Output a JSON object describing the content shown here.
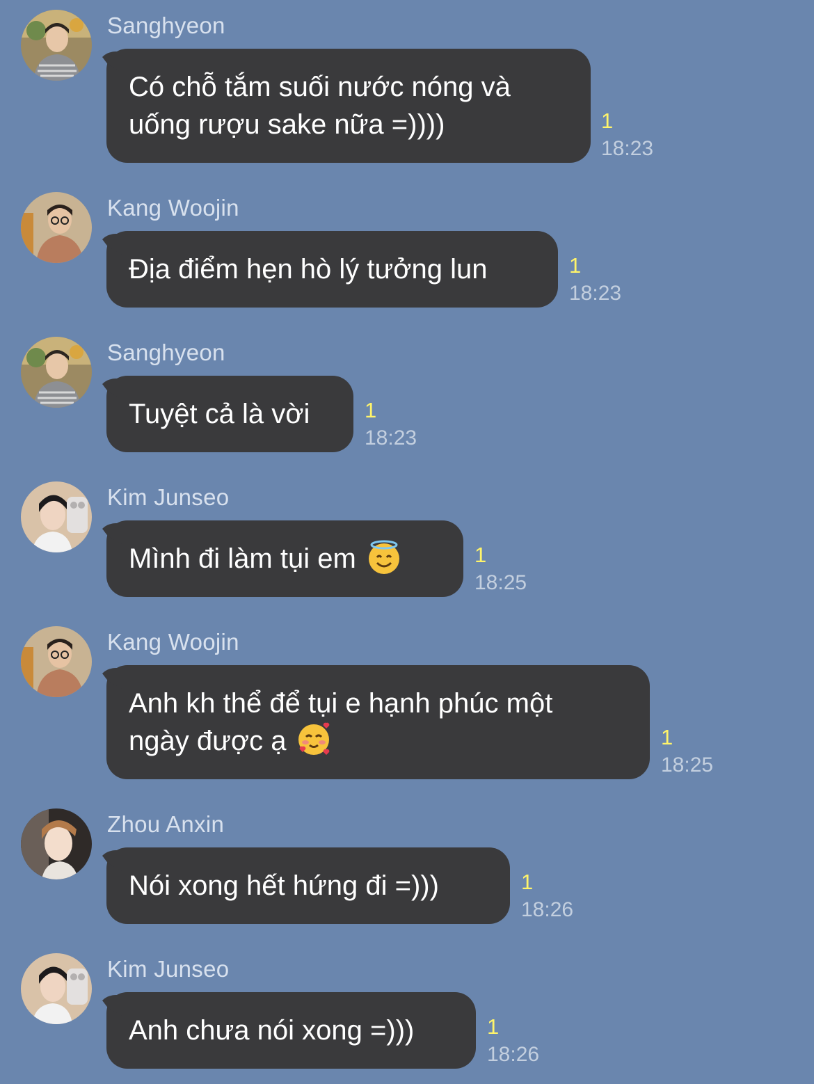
{
  "colors": {
    "background": "#6a86ae",
    "bubble": "#3a3a3c",
    "unread": "#fff46a",
    "time": "#c3cfdf"
  },
  "messages": [
    {
      "sender": "Sanghyeon",
      "avatar": "avatar-sanghyeon",
      "text": "Có chỗ tắm suối nước nóng và\nuống rượu sake nữa =))))",
      "unread": "1",
      "time": "18:23"
    },
    {
      "sender": "Kang Woojin",
      "avatar": "avatar-kang-woojin",
      "text": "Địa điểm hẹn hò lý tưởng lun",
      "unread": "1",
      "time": "18:23"
    },
    {
      "sender": "Sanghyeon",
      "avatar": "avatar-sanghyeon",
      "text": "Tuyệt cả là vời",
      "unread": "1",
      "time": "18:23"
    },
    {
      "sender": "Kim Junseo",
      "avatar": "avatar-kim-junseo",
      "text": "Mình đi làm tụi em",
      "emoji": "smiling-face-with-halo-emoji",
      "unread": "1",
      "time": "18:25"
    },
    {
      "sender": "Kang Woojin",
      "avatar": "avatar-kang-woojin",
      "text": "Anh kh thể để tụi e hạnh phúc một\nngày được ạ",
      "emoji": "smiling-face-with-hearts-emoji",
      "unread": "1",
      "time": "18:25"
    },
    {
      "sender": "Zhou Anxin",
      "avatar": "avatar-zhou-anxin",
      "text": "Nói xong hết hứng đi =)))",
      "unread": "1",
      "time": "18:26"
    },
    {
      "sender": "Kim Junseo",
      "avatar": "avatar-kim-junseo",
      "text": "Anh chưa nói xong =)))",
      "unread": "1",
      "time": "18:26"
    }
  ]
}
